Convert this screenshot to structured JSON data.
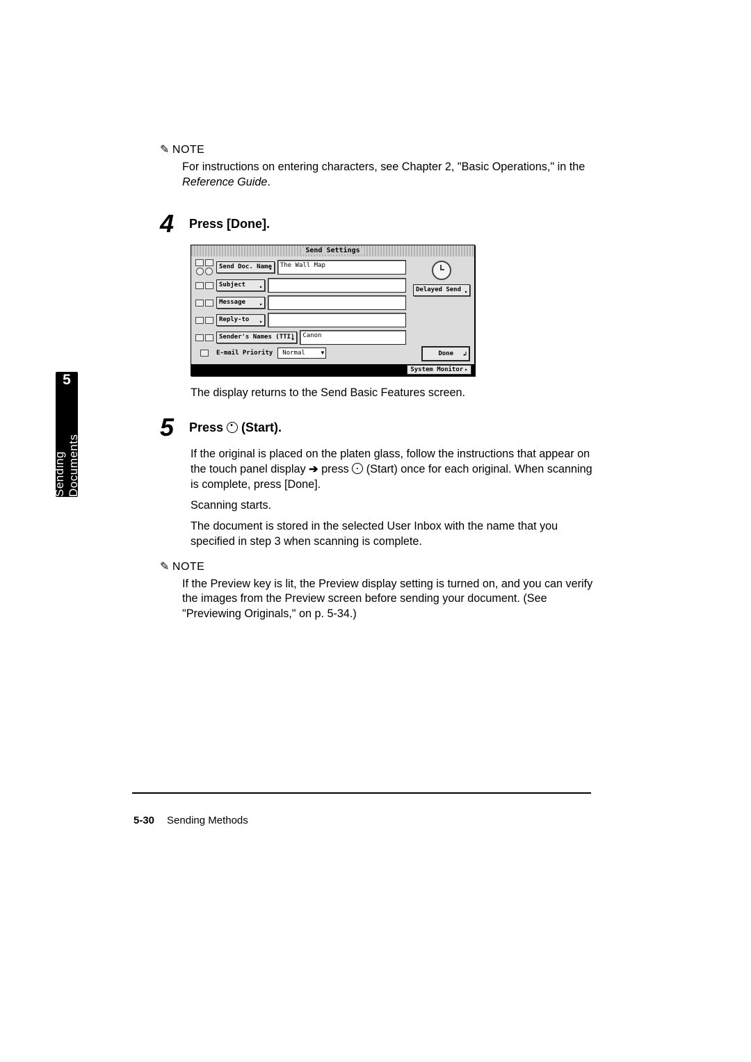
{
  "side_tab": {
    "number": "5",
    "label": "Sending Documents"
  },
  "note1": {
    "label": "NOTE",
    "text_a": "For instructions on entering characters, see Chapter 2, \"Basic Operations,\" in the ",
    "text_b": "Reference Guide",
    "text_c": "."
  },
  "step4": {
    "num": "4",
    "title": "Press [Done].",
    "after": "The display returns to the Send Basic Features screen."
  },
  "screenshot": {
    "title": "Send Settings",
    "rows": {
      "doc_name": {
        "label": "Send Doc. Name",
        "value": "The Wall Map"
      },
      "subject": {
        "label": "Subject",
        "value": ""
      },
      "message": {
        "label": "Message",
        "value": ""
      },
      "reply_to": {
        "label": "Reply-to",
        "value": ""
      },
      "sender": {
        "label": "Sender's Names (TTI)",
        "value": "Canon"
      },
      "priority": {
        "label": "E-mail Priority",
        "value": "Normal"
      }
    },
    "right": {
      "delayed": "Delayed Send"
    },
    "done": "Done",
    "system_monitor": "System Monitor"
  },
  "step5": {
    "num": "5",
    "title_a": "Press ",
    "title_b": " (Start).",
    "p1_a": "If the original is placed on the platen glass, follow the instructions that appear on the touch panel display ",
    "p1_b": " press ",
    "p1_c": " (Start) once for each original. When scanning is complete, press [Done].",
    "p2": "Scanning starts.",
    "p3": "The document is stored in the selected User Inbox with the name that you specified in step 3 when scanning is complete."
  },
  "note2": {
    "label": "NOTE",
    "text": "If the Preview key is lit, the Preview display setting is turned on, and you can verify the images from the Preview screen before sending your document. (See \"Previewing Originals,\" on p. 5-34.)"
  },
  "footer": {
    "page": "5-30",
    "section": "Sending Methods"
  }
}
